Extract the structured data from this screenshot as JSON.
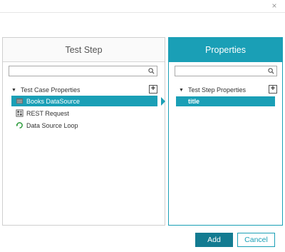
{
  "dialog": {
    "close_glyph": "×"
  },
  "left_panel": {
    "title": "Test Step",
    "search": {
      "value": "",
      "placeholder": ""
    },
    "tree_root": "Test Case Properties",
    "add_glyph": "+",
    "items": [
      {
        "label": "Books DataSource",
        "icon": "datasource-icon",
        "selected": true
      },
      {
        "label": "REST Request",
        "icon": "rest-request-icon",
        "selected": false
      },
      {
        "label": "Data Source Loop",
        "icon": "loop-icon",
        "selected": false
      }
    ]
  },
  "right_panel": {
    "title": "Properties",
    "search": {
      "value": "",
      "placeholder": ""
    },
    "tree_root": "Test Step Properties",
    "add_glyph": "+",
    "selected_property": "title"
  },
  "footer": {
    "add_label": "Add",
    "cancel_label": "Cancel"
  },
  "colors": {
    "accent": "#1a9fb6",
    "primary_button": "#137b91"
  }
}
